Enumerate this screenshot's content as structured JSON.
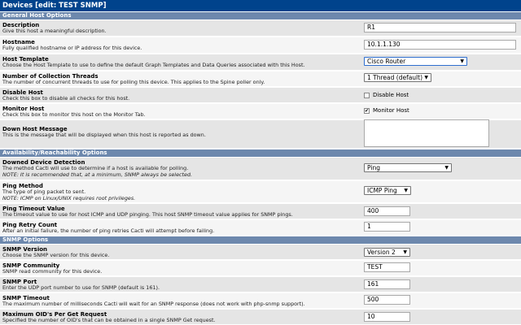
{
  "header": {
    "title": "Devices",
    "edit_label": "[edit: TEST SNMP]"
  },
  "sections": {
    "general": "General Host Options",
    "availability": "Availability/Reachability Options",
    "snmp": "SNMP Options"
  },
  "fields": {
    "description": {
      "title": "Description",
      "desc": "Give this host a meaningful description.",
      "value": "R1"
    },
    "hostname": {
      "title": "Hostname",
      "desc": "Fully qualified hostname or IP address for this device.",
      "value": "10.1.1.130"
    },
    "host_template": {
      "title": "Host Template",
      "desc": "Choose the Host Template to use to define the default Graph Templates and Data Queries associated with this Host.",
      "value": "Cisco Router"
    },
    "threads": {
      "title": "Number of Collection Threads",
      "desc": "The number of concurrent threads to use for polling this device. This applies to the Spine poller only.",
      "value": "1 Thread (default)"
    },
    "disable_host": {
      "title": "Disable Host",
      "desc": "Check this box to disable all checks for this host.",
      "checkbox_label": "Disable Host",
      "checked": false
    },
    "monitor_host": {
      "title": "Monitor Host",
      "desc": "Check this box to monitor this host on the Monitor Tab.",
      "checkbox_label": "Monitor Host",
      "checked": true
    },
    "down_message": {
      "title": "Down Host Message",
      "desc": "This is the message that will be displayed when this host is reported as down.",
      "value": ""
    },
    "downed_detection": {
      "title": "Downed Device Detection",
      "desc": "The method Cacti will use to determine if a host is available for polling.",
      "note": "NOTE: It is recommended that, at a minimum, SNMP always be selected.",
      "value": "Ping"
    },
    "ping_method": {
      "title": "Ping Method",
      "desc": "The type of ping packet to sent.",
      "note": "NOTE: ICMP on Linux/UNIX requires root privileges.",
      "value": "ICMP Ping"
    },
    "ping_timeout": {
      "title": "Ping Timeout Value",
      "desc": "The timeout value to use for host ICMP and UDP pinging. This host SNMP timeout value applies for SNMP pings.",
      "value": "400"
    },
    "ping_retry": {
      "title": "Ping Retry Count",
      "desc": "After an initial failure, the number of ping retries Cacti will attempt before failing.",
      "value": "1"
    },
    "snmp_version": {
      "title": "SNMP Version",
      "desc": "Choose the SNMP version for this device.",
      "value": "Version 2"
    },
    "snmp_community": {
      "title": "SNMP Community",
      "desc": "SNMP read community for this device.",
      "value": "TEST"
    },
    "snmp_port": {
      "title": "SNMP Port",
      "desc": "Enter the UDP port number to use for SNMP (default is 161).",
      "value": "161"
    },
    "snmp_timeout": {
      "title": "SNMP Timeout",
      "desc": "The maximum number of milliseconds Cacti will wait for an SNMP response (does not work with php-snmp support).",
      "value": "500"
    },
    "max_oids": {
      "title": "Maximum OID's Per Get Request",
      "desc": "Specified the number of OID's that can be obtained in a single SNMP Get request.",
      "value": "10"
    }
  },
  "icons": {
    "dropdown": "chevron-down-icon",
    "check": "checkmark-icon"
  },
  "colors": {
    "title_bar": "#00438C",
    "section_bar": "#6D88AD",
    "row_dark": "#E5E5E5",
    "row_light": "#F5F5F5"
  }
}
